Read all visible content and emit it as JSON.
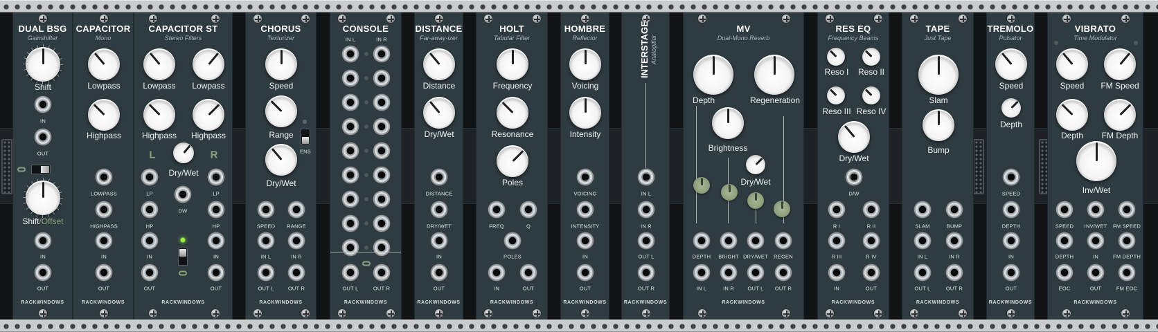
{
  "rack": {
    "brand": "RACKWINDOWS",
    "modules": [
      {
        "id": "dual-bsg",
        "title": "DUAL BSG",
        "subtitle": "Gainshifter",
        "knobs": [
          {
            "label": "Shift",
            "value": 0.5
          },
          {
            "label_a": "Shift",
            "label_b": "/Offset",
            "value": 0.5
          }
        ],
        "ports": [
          "IN",
          "OUT",
          "IN",
          "OUT"
        ]
      },
      {
        "id": "capacitor",
        "title": "CAPACITOR",
        "subtitle": "Mono",
        "knobs": [
          {
            "label": "Lowpass",
            "value": 0.32
          },
          {
            "label": "Highpass",
            "value": 0.3
          }
        ],
        "ports": [
          "LOWPASS",
          "HIGHPASS",
          "IN",
          "OUT"
        ]
      },
      {
        "id": "capacitor-st",
        "title": "CAPACITOR ST",
        "subtitle": "Stereo Filters",
        "knobs": [
          {
            "label": "Lowpass",
            "value": 0.32
          },
          {
            "label": "Lowpass",
            "value": 0.7
          },
          {
            "label": "Highpass",
            "value": 0.3
          },
          {
            "label": "Highpass",
            "value": 0.7
          },
          {
            "label": "Dry/Wet",
            "value": 0.8
          }
        ],
        "channel_left": "L",
        "channel_right": "R",
        "ports": [
          "LP",
          "LP",
          "DW",
          "HP",
          "HP",
          "IN",
          "IN",
          "OUT",
          "OUT"
        ]
      },
      {
        "id": "chorus",
        "title": "CHORUS",
        "subtitle": "Texturizer",
        "knobs": [
          {
            "label": "Speed",
            "value": 0.5
          },
          {
            "label": "Range",
            "value": 0.35
          },
          {
            "label": "Dry/Wet",
            "value": 0.3
          }
        ],
        "switch_label": "ENS",
        "ports": [
          "SPEED",
          "RANGE",
          "IN L",
          "IN R",
          "OUT L",
          "OUT R"
        ]
      },
      {
        "id": "console",
        "title": "CONSOLE",
        "column_labels": [
          "IN L",
          "IN R"
        ],
        "ports": [
          "OUT L",
          "OUT R"
        ]
      },
      {
        "id": "distance",
        "title": "DISTANCE",
        "subtitle": "Far-away-izer",
        "knobs": [
          {
            "label": "Distance",
            "value": 0.35
          },
          {
            "label": "Dry/Wet",
            "value": 0.35
          }
        ],
        "ports": [
          "DISTANCE",
          "DRY/WET",
          "IN",
          "OUT"
        ]
      },
      {
        "id": "holt",
        "title": "HOLT",
        "subtitle": "Tabular Filter",
        "knobs": [
          {
            "label": "Frequency",
            "value": 0.5
          },
          {
            "label": "Resonance",
            "value": 0.3
          },
          {
            "label": "Poles",
            "value": 0.7
          }
        ],
        "ports": [
          "FREQ",
          "Q",
          "POLES",
          "IN",
          "OUT"
        ]
      },
      {
        "id": "hombre",
        "title": "HOMBRE",
        "subtitle": "Reflector",
        "knobs": [
          {
            "label": "Voicing",
            "value": 0.5
          },
          {
            "label": "Intensity",
            "value": 0.5
          }
        ],
        "ports": [
          "VOICING",
          "INTENSITY",
          "IN",
          "OUT"
        ]
      },
      {
        "id": "interstage",
        "title": "INTERSTAGE",
        "subtitle": "Analogifier",
        "ports": [
          "IN L",
          "IN R",
          "OUT L",
          "OUT R"
        ]
      },
      {
        "id": "mv",
        "title": "MV",
        "subtitle": "Dual-Mono Reverb",
        "knobs": [
          {
            "label": "Depth",
            "value": 0.5
          },
          {
            "label": "Regeneration",
            "value": 0.5
          },
          {
            "label": "Brightness",
            "value": 0.5
          },
          {
            "label": "Dry/Wet",
            "value": 0.7
          }
        ],
        "ports": [
          "DEPTH",
          "BRIGHT",
          "DRY/WET",
          "REGEN",
          "IN L",
          "IN R",
          "OUT L",
          "OUT R"
        ]
      },
      {
        "id": "res-eq",
        "title": "RES EQ",
        "subtitle": "Frequency Beams",
        "knobs": [
          {
            "label": "Reso I",
            "value": 0.3
          },
          {
            "label": "Reso II",
            "value": 0.3
          },
          {
            "label": "Reso III",
            "value": 0.3
          },
          {
            "label": "Reso IV",
            "value": 0.3
          },
          {
            "label": "Dry/Wet",
            "value": 0.35
          }
        ],
        "ports": [
          "D/W",
          "R I",
          "R II",
          "R III",
          "R IV",
          "IN",
          "OUT"
        ]
      },
      {
        "id": "tape",
        "title": "TAPE",
        "subtitle": "Just Tape",
        "knobs": [
          {
            "label": "Slam",
            "value": 0.5
          },
          {
            "label": "Bump",
            "value": 0.5
          }
        ],
        "ports": [
          "SLAM",
          "BUMP",
          "IN L",
          "IN R",
          "OUT L",
          "OUT R"
        ]
      },
      {
        "id": "tremolo",
        "title": "TREMOLO",
        "subtitle": "Pulsator",
        "knobs": [
          {
            "label": "Speed",
            "value": 0.35
          },
          {
            "label": "Depth",
            "value": 0.7
          }
        ],
        "ports": [
          "SPEED",
          "DEPTH",
          "IN",
          "OUT"
        ]
      },
      {
        "id": "vibrato",
        "title": "VIBRATO",
        "subtitle": "Time Modulator",
        "knobs": [
          {
            "label": "Speed",
            "value": 0.3
          },
          {
            "label": "FM Speed",
            "value": 0.7
          },
          {
            "label": "Depth",
            "value": 0.3
          },
          {
            "label": "FM Depth",
            "value": 0.7
          },
          {
            "label": "Inv/Wet",
            "value": 0.5
          }
        ],
        "ports": [
          "SPEED",
          "INV/WET",
          "FM SPEED",
          "DEPTH",
          "IN",
          "FM DEPTH",
          "EOC",
          "OUT",
          "FM EOC"
        ]
      }
    ]
  }
}
